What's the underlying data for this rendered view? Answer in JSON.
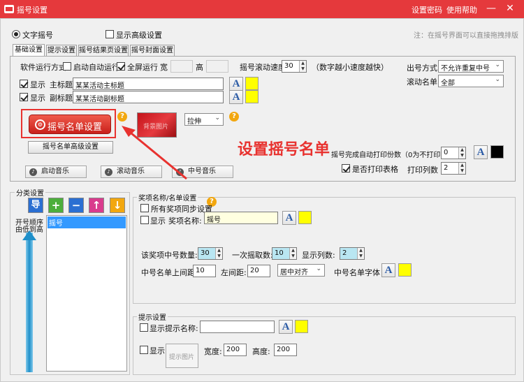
{
  "window": {
    "title": "摇号设置",
    "links": {
      "password": "设置密码",
      "help": "使用帮助"
    },
    "controls": {
      "minimize": "—",
      "close": "✕"
    }
  },
  "top": {
    "radio_label": "文字摇号",
    "advanced_label": "显示高级设置",
    "hint": "注：在摇号界面可以直接拖拽排版"
  },
  "tabs": [
    "基础设置",
    "提示设置",
    "摇号结果页设置",
    "摇号封面设置"
  ],
  "basic": {
    "run_mode_label": "软件运行方式",
    "auto_start_label": "启动自动运行",
    "fullscreen_label": "全屏运行",
    "width_label": "宽",
    "height_label": "高",
    "speed_label": "摇号滚动速度",
    "speed_value": "30",
    "speed_hint": "（数字越小速度越快）",
    "show_label": "显示",
    "main_title_label": "主标题",
    "main_title_value": "某某活动主标题",
    "sub_title_label": "副标题",
    "sub_title_value": "某某活动副标题",
    "list_button_label": "摇号名单设置",
    "bg_image_label": "背景图片",
    "stretch_value": "拉伸",
    "advanced_list_button": "摇号名单高级设置",
    "music_start": "启动音乐",
    "music_roll": "滚动音乐",
    "music_win": "中号音乐",
    "annotation": "设置摇号名单",
    "draw_mode_label": "出号方式",
    "draw_mode_value": "不允许重复中号",
    "roll_list_label": "滚动名单",
    "roll_list_value": "全部",
    "print_copies_label": "摇号完成自动打印份数（0为不打印）",
    "print_copies_value": "0",
    "print_table_label": "是否打印表格",
    "print_cols_label": "打印列数",
    "print_cols_value": "2"
  },
  "category": {
    "title": "分类设置",
    "import_label": "导",
    "order_label_1": "开号顺序",
    "order_label_2": "由低到高",
    "items": [
      "摇号"
    ]
  },
  "award": {
    "title": "奖项名称/名单设置",
    "sync_label": "所有奖项同步设置",
    "show_label": "显示",
    "name_label": "奖项名称:",
    "name_value": "摇号",
    "count_label": "该奖项中号数量:",
    "count_value": "30",
    "each_label": "一次摇取数:",
    "each_value": "10",
    "cols_label": "显示列数:",
    "cols_value": "2",
    "top_margin_label": "中号名单上间距:",
    "top_margin_value": "10",
    "left_margin_label": "左间距:",
    "left_margin_value": "20",
    "align_value": "居中对齐",
    "font_label": "中号名单字体"
  },
  "prompt": {
    "title": "提示设置",
    "show_label": "显示",
    "name_label": "提示名称:",
    "name_value": "",
    "image_label": "提示图片",
    "width_label": "宽度:",
    "width_value": "200",
    "height_label": "高度:",
    "height_value": "200"
  },
  "font_glyph": "A",
  "colors": {
    "titlebar": "#e5393c",
    "swatch_yellow": "#ffff00",
    "swatch_black": "#000000",
    "annotation_red": "#e8322f",
    "help_icon": "#f2a70f"
  }
}
